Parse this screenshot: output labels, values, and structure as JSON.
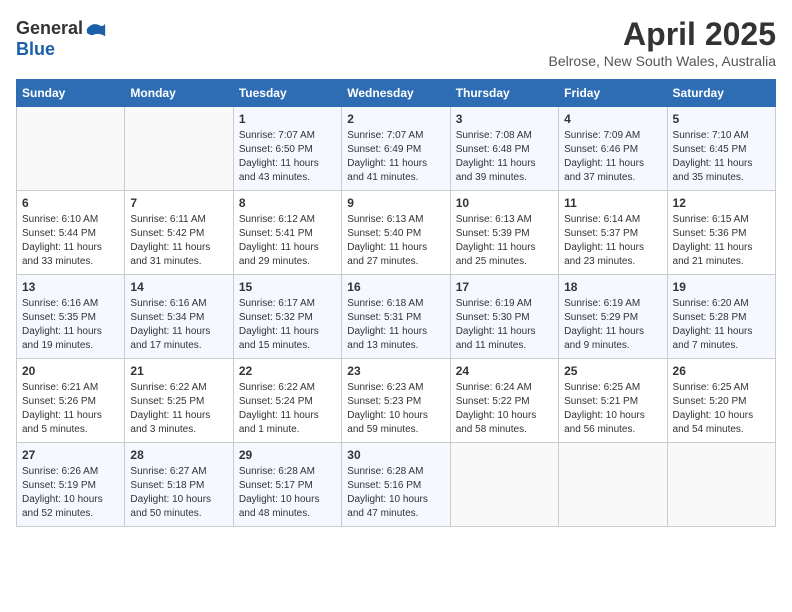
{
  "header": {
    "logo_general": "General",
    "logo_blue": "Blue",
    "month_title": "April 2025",
    "location": "Belrose, New South Wales, Australia"
  },
  "days_of_week": [
    "Sunday",
    "Monday",
    "Tuesday",
    "Wednesday",
    "Thursday",
    "Friday",
    "Saturday"
  ],
  "weeks": [
    [
      {
        "day": "",
        "info": ""
      },
      {
        "day": "",
        "info": ""
      },
      {
        "day": "1",
        "info": "Sunrise: 7:07 AM\nSunset: 6:50 PM\nDaylight: 11 hours and 43 minutes."
      },
      {
        "day": "2",
        "info": "Sunrise: 7:07 AM\nSunset: 6:49 PM\nDaylight: 11 hours and 41 minutes."
      },
      {
        "day": "3",
        "info": "Sunrise: 7:08 AM\nSunset: 6:48 PM\nDaylight: 11 hours and 39 minutes."
      },
      {
        "day": "4",
        "info": "Sunrise: 7:09 AM\nSunset: 6:46 PM\nDaylight: 11 hours and 37 minutes."
      },
      {
        "day": "5",
        "info": "Sunrise: 7:10 AM\nSunset: 6:45 PM\nDaylight: 11 hours and 35 minutes."
      }
    ],
    [
      {
        "day": "6",
        "info": "Sunrise: 6:10 AM\nSunset: 5:44 PM\nDaylight: 11 hours and 33 minutes."
      },
      {
        "day": "7",
        "info": "Sunrise: 6:11 AM\nSunset: 5:42 PM\nDaylight: 11 hours and 31 minutes."
      },
      {
        "day": "8",
        "info": "Sunrise: 6:12 AM\nSunset: 5:41 PM\nDaylight: 11 hours and 29 minutes."
      },
      {
        "day": "9",
        "info": "Sunrise: 6:13 AM\nSunset: 5:40 PM\nDaylight: 11 hours and 27 minutes."
      },
      {
        "day": "10",
        "info": "Sunrise: 6:13 AM\nSunset: 5:39 PM\nDaylight: 11 hours and 25 minutes."
      },
      {
        "day": "11",
        "info": "Sunrise: 6:14 AM\nSunset: 5:37 PM\nDaylight: 11 hours and 23 minutes."
      },
      {
        "day": "12",
        "info": "Sunrise: 6:15 AM\nSunset: 5:36 PM\nDaylight: 11 hours and 21 minutes."
      }
    ],
    [
      {
        "day": "13",
        "info": "Sunrise: 6:16 AM\nSunset: 5:35 PM\nDaylight: 11 hours and 19 minutes."
      },
      {
        "day": "14",
        "info": "Sunrise: 6:16 AM\nSunset: 5:34 PM\nDaylight: 11 hours and 17 minutes."
      },
      {
        "day": "15",
        "info": "Sunrise: 6:17 AM\nSunset: 5:32 PM\nDaylight: 11 hours and 15 minutes."
      },
      {
        "day": "16",
        "info": "Sunrise: 6:18 AM\nSunset: 5:31 PM\nDaylight: 11 hours and 13 minutes."
      },
      {
        "day": "17",
        "info": "Sunrise: 6:19 AM\nSunset: 5:30 PM\nDaylight: 11 hours and 11 minutes."
      },
      {
        "day": "18",
        "info": "Sunrise: 6:19 AM\nSunset: 5:29 PM\nDaylight: 11 hours and 9 minutes."
      },
      {
        "day": "19",
        "info": "Sunrise: 6:20 AM\nSunset: 5:28 PM\nDaylight: 11 hours and 7 minutes."
      }
    ],
    [
      {
        "day": "20",
        "info": "Sunrise: 6:21 AM\nSunset: 5:26 PM\nDaylight: 11 hours and 5 minutes."
      },
      {
        "day": "21",
        "info": "Sunrise: 6:22 AM\nSunset: 5:25 PM\nDaylight: 11 hours and 3 minutes."
      },
      {
        "day": "22",
        "info": "Sunrise: 6:22 AM\nSunset: 5:24 PM\nDaylight: 11 hours and 1 minute."
      },
      {
        "day": "23",
        "info": "Sunrise: 6:23 AM\nSunset: 5:23 PM\nDaylight: 10 hours and 59 minutes."
      },
      {
        "day": "24",
        "info": "Sunrise: 6:24 AM\nSunset: 5:22 PM\nDaylight: 10 hours and 58 minutes."
      },
      {
        "day": "25",
        "info": "Sunrise: 6:25 AM\nSunset: 5:21 PM\nDaylight: 10 hours and 56 minutes."
      },
      {
        "day": "26",
        "info": "Sunrise: 6:25 AM\nSunset: 5:20 PM\nDaylight: 10 hours and 54 minutes."
      }
    ],
    [
      {
        "day": "27",
        "info": "Sunrise: 6:26 AM\nSunset: 5:19 PM\nDaylight: 10 hours and 52 minutes."
      },
      {
        "day": "28",
        "info": "Sunrise: 6:27 AM\nSunset: 5:18 PM\nDaylight: 10 hours and 50 minutes."
      },
      {
        "day": "29",
        "info": "Sunrise: 6:28 AM\nSunset: 5:17 PM\nDaylight: 10 hours and 48 minutes."
      },
      {
        "day": "30",
        "info": "Sunrise: 6:28 AM\nSunset: 5:16 PM\nDaylight: 10 hours and 47 minutes."
      },
      {
        "day": "",
        "info": ""
      },
      {
        "day": "",
        "info": ""
      },
      {
        "day": "",
        "info": ""
      }
    ]
  ]
}
